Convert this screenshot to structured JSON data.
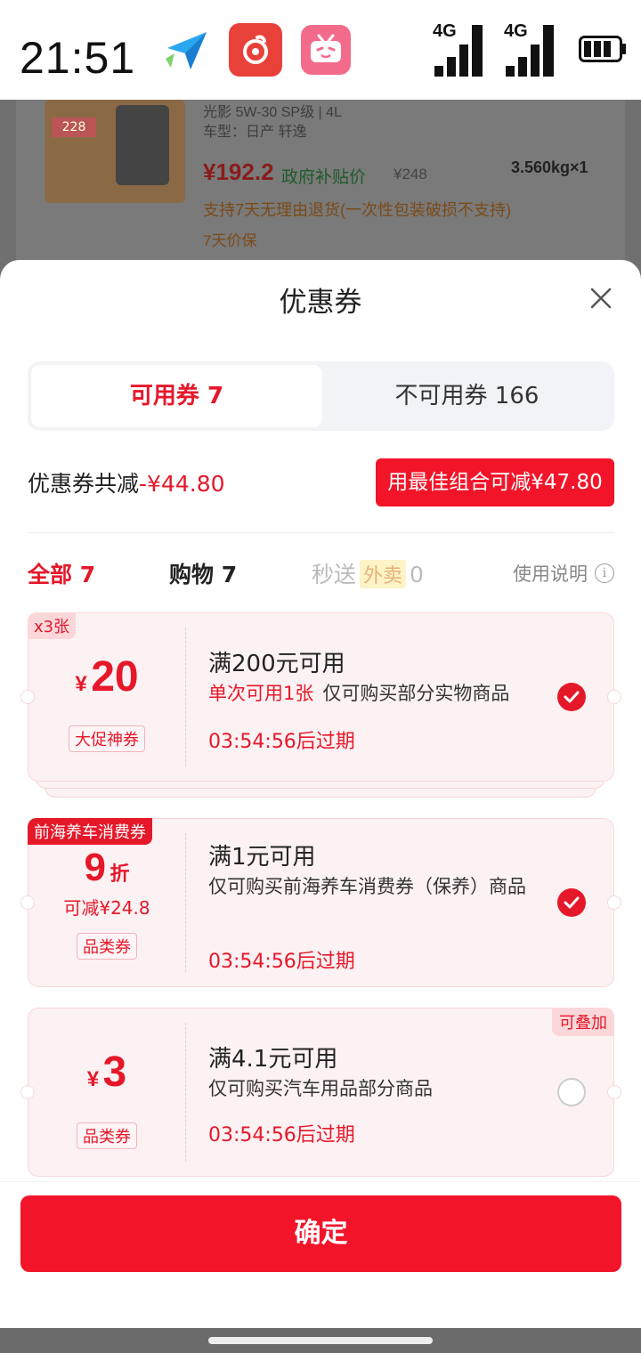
{
  "status_bar": {
    "time": "21:51",
    "network_1": "4G",
    "network_2": "4G",
    "icons": [
      "send-arrow-icon",
      "music-app-icon",
      "video-app-icon",
      "signal-icon",
      "battery-icon"
    ]
  },
  "background_product": {
    "spec": "光影 5W-30 SP级 | 4L",
    "model": "车型：日产 轩逸",
    "price": "¥192.2",
    "subsidy_label": "政府补贴价",
    "original_price": "¥248",
    "weight_qty": "3.560kg×1",
    "return_policy": "支持7天无理由退货(一次性包装破损不支持)",
    "price_protect": "7天价保",
    "thumb_tag": "228"
  },
  "sheet": {
    "title": "优惠券",
    "tabs": {
      "available": "可用券 7",
      "unavailable": "不可用券 166"
    },
    "summary_label": "优惠券共减",
    "summary_amount": "-¥44.80",
    "best_combo_button": "用最佳组合可减¥47.80",
    "filters": {
      "all": "全部 7",
      "shopping": "购物 7",
      "fast_label": "秒送",
      "fast_tag": "外卖",
      "fast_count": "0",
      "help": "使用说明"
    }
  },
  "coupons": [
    {
      "corner_tag": "x3张",
      "currency": "¥",
      "value": "20",
      "kind": "大促神券",
      "title": "满200元可用",
      "desc_highlight": "单次可用1张",
      "desc": "仅可购买部分实物商品",
      "expiry": "03:54:56后过期",
      "selected": true
    },
    {
      "corner_tag": "前海养车消费券",
      "value": "9",
      "unit": "折",
      "sub": "可减¥24.8",
      "kind": "品类券",
      "title": "满1元可用",
      "desc": "仅可购买前海养车消费券（保养）商品",
      "expiry": "03:54:56后过期",
      "selected": true
    },
    {
      "right_tag": "可叠加",
      "currency": "¥",
      "value": "3",
      "kind": "品类券",
      "title": "满4.1元可用",
      "desc": "仅可购买汽车用品部分商品",
      "expiry": "03:54:56后过期",
      "selected": false
    }
  ],
  "footer": {
    "confirm": "确定"
  },
  "colors": {
    "accent_red": "#e5182a",
    "button_red": "#f2152a",
    "coupon_bg": "#fdf2f3"
  }
}
